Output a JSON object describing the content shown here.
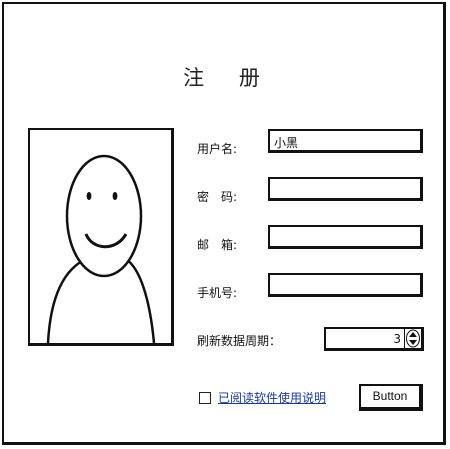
{
  "form": {
    "title": "注 册",
    "username_label": "用户名:",
    "username_value": "小黑",
    "password_label": "密　码:",
    "password_value": "",
    "email_label": "邮　箱:",
    "email_value": "",
    "phone_label": "手机号:",
    "phone_value": "",
    "refresh_label": "刷新数据周期：",
    "refresh_value": "3",
    "agree_label": "已阅读软件使用说明",
    "agree_checked": false,
    "button_label": "Button"
  },
  "icons": {
    "avatar": "smiley-person-icon",
    "stepper_arrows": "up-down-arrows-icon"
  }
}
